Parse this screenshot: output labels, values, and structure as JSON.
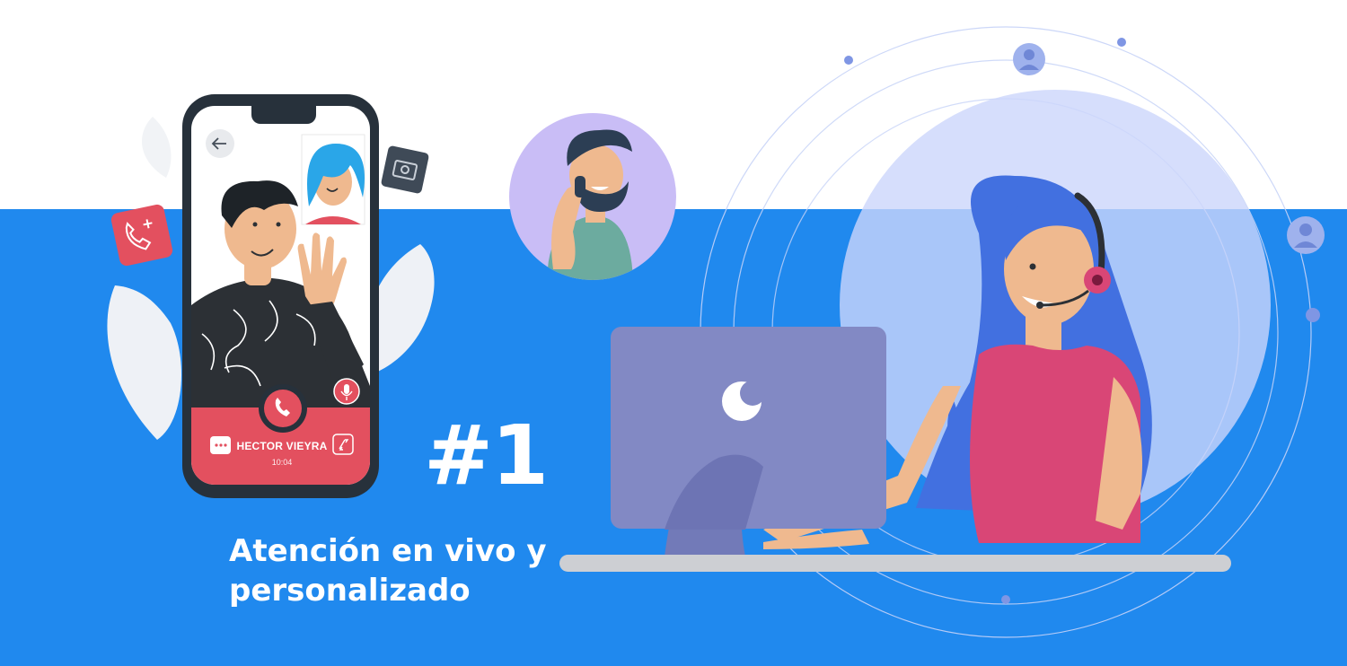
{
  "call": {
    "caller_name": "HECTOR VIEYRA",
    "duration": "10:04"
  },
  "headline": "#1",
  "tagline": [
    "Atención en vivo y",
    "personalizado"
  ],
  "colors": {
    "band_blue": "#2089ee",
    "call_red": "#e3505f",
    "phone_frame": "#27313b",
    "monitor": "#8289c4",
    "agent_dress": "#d94676",
    "agent_hair": "#4270e0",
    "skin": "#efb98f"
  },
  "icons": [
    "back-arrow-icon",
    "camera-icon",
    "phone-add-icon",
    "end-call-icon",
    "microphone-icon",
    "chat-icon",
    "switch-camera-icon",
    "user-icon",
    "headset-icon"
  ]
}
